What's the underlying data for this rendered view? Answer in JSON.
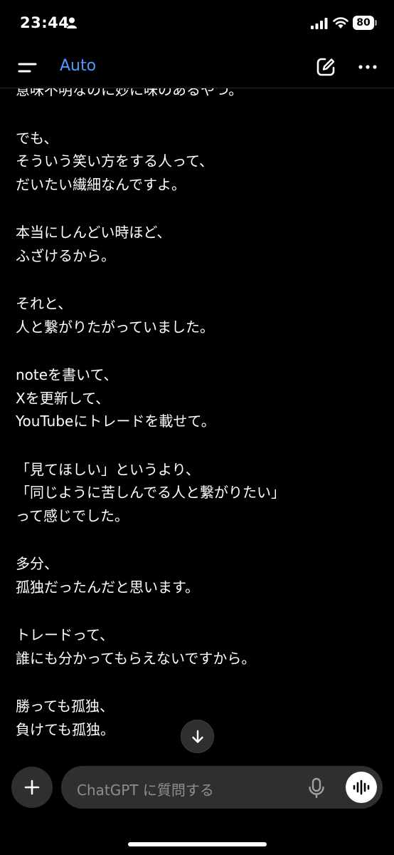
{
  "status_bar": {
    "time": "23:44",
    "battery": "80"
  },
  "header": {
    "model": "Auto"
  },
  "chat": {
    "paragraphs": [
      [
        "意味不明なのに妙に味のあるやつ。"
      ],
      [
        "でも、",
        "そういう笑い方をする人って、",
        "だいたい繊細なんですよ。"
      ],
      [
        "本当にしんどい時ほど、",
        "ふざけるから。"
      ],
      [
        "それと、",
        "人と繋がりたがっていました。"
      ],
      [
        "noteを書いて、",
        "Xを更新して、",
        "YouTubeにトレードを載せて。"
      ],
      [
        "「見てほしい」というより、",
        "「同じように苦しんでる人と繋がりたい」",
        "って感じでした。"
      ],
      [
        "多分、",
        "孤独だったんだと思います。"
      ],
      [
        "トレードって、",
        "誰にも分かってもらえないですから。"
      ],
      [
        "勝っても孤独、",
        "負けても孤独。"
      ]
    ]
  },
  "composer": {
    "placeholder": "ChatGPT に質問する"
  },
  "icons": {
    "menu": "menu-icon",
    "new_chat": "new-chat-icon",
    "more": "more-icon",
    "scroll_down": "arrow-down-icon",
    "plus": "plus-icon",
    "mic": "mic-icon",
    "voice": "voice-wave-icon"
  },
  "colors": {
    "background": "#000000",
    "accent": "#4d9bff",
    "surface": "#2f2f2f"
  }
}
